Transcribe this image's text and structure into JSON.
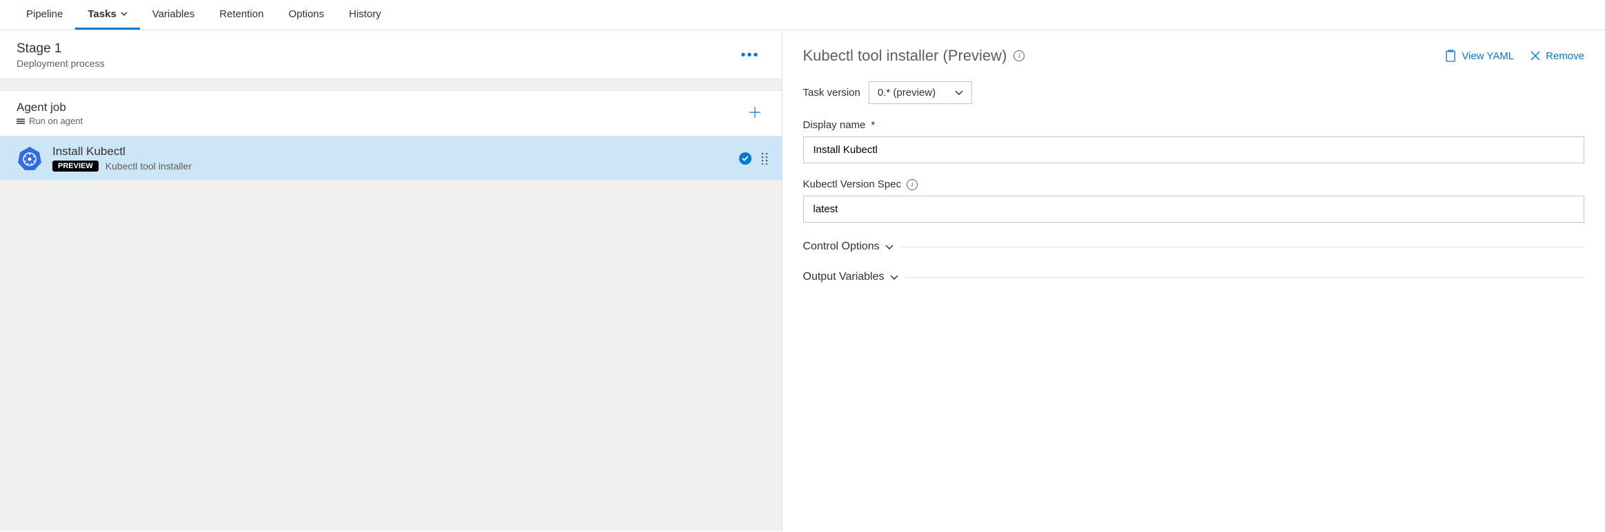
{
  "tabs": {
    "pipeline": "Pipeline",
    "tasks": "Tasks",
    "variables": "Variables",
    "retention": "Retention",
    "options": "Options",
    "history": "History"
  },
  "stage": {
    "name": "Stage 1",
    "subtitle": "Deployment process"
  },
  "job": {
    "name": "Agent job",
    "subtitle": "Run on agent"
  },
  "task": {
    "name": "Install Kubectl",
    "badge": "PREVIEW",
    "description": "Kubectl tool installer"
  },
  "panel": {
    "title": "Kubectl tool installer (Preview)",
    "view_yaml": "View YAML",
    "remove": "Remove",
    "task_version_label": "Task version",
    "task_version_value": "0.* (preview)",
    "display_name_label": "Display name",
    "display_name_value": "Install Kubectl",
    "version_spec_label": "Kubectl Version Spec",
    "version_spec_value": "latest",
    "control_options": "Control Options",
    "output_variables": "Output Variables"
  }
}
